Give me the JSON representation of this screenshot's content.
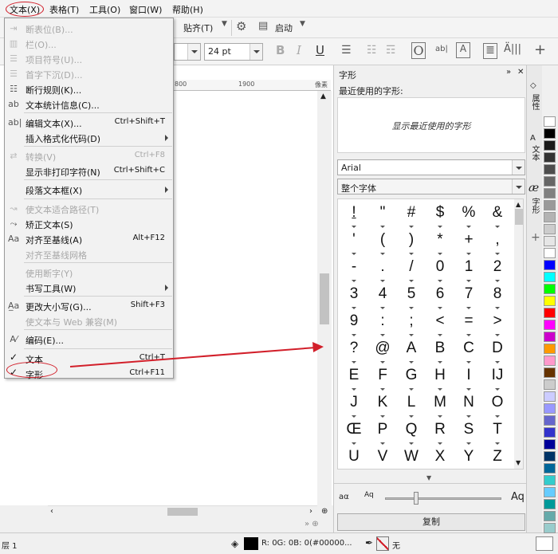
{
  "menubar": {
    "items": [
      "文本(X)",
      "表格(T)",
      "工具(O)",
      "窗口(W)",
      "帮助(H)"
    ]
  },
  "toolbar": {
    "snap_label": "贴齐(T)",
    "launch_label": "启动",
    "font_size": "24 pt"
  },
  "ruler": {
    "mark1": "800",
    "mark2": "1900",
    "unit": "像素"
  },
  "text_menu": {
    "items": [
      {
        "label": "断表位(B)...",
        "shortcut": "",
        "disabled": true,
        "submenu": false
      },
      {
        "label": "栏(O)...",
        "shortcut": "",
        "disabled": true,
        "submenu": false
      },
      {
        "label": "项目符号(U)...",
        "shortcut": "",
        "disabled": true,
        "submenu": false
      },
      {
        "label": "首字下沉(D)...",
        "shortcut": "",
        "disabled": true,
        "submenu": false
      },
      {
        "label": "断行规则(K)...",
        "shortcut": "",
        "disabled": false,
        "submenu": false
      },
      {
        "label": "文本统计信息(C)...",
        "shortcut": "",
        "disabled": false,
        "submenu": false
      },
      {
        "label": "编辑文本(X)...",
        "shortcut": "Ctrl+Shift+T",
        "disabled": false,
        "submenu": false
      },
      {
        "label": "插入格式化代码(D)",
        "shortcut": "",
        "disabled": false,
        "submenu": true
      },
      {
        "label": "转换(V)",
        "shortcut": "Ctrl+F8",
        "disabled": true,
        "submenu": false
      },
      {
        "label": "显示非打印字符(N)",
        "shortcut": "Ctrl+Shift+C",
        "disabled": false,
        "submenu": false
      },
      {
        "label": "段落文本框(X)",
        "shortcut": "",
        "disabled": false,
        "submenu": true
      },
      {
        "label": "使文本适合路径(T)",
        "shortcut": "",
        "disabled": true,
        "submenu": false
      },
      {
        "label": "矫正文本(S)",
        "shortcut": "",
        "disabled": false,
        "submenu": false
      },
      {
        "label": "对齐至基线(A)",
        "shortcut": "Alt+F12",
        "disabled": false,
        "submenu": false
      },
      {
        "label": "对齐至基线网格",
        "shortcut": "",
        "disabled": true,
        "submenu": false
      },
      {
        "label": "使用断字(Y)",
        "shortcut": "",
        "disabled": true,
        "submenu": false
      },
      {
        "label": "书写工具(W)",
        "shortcut": "",
        "disabled": false,
        "submenu": true
      },
      {
        "label": "更改大小写(G)...",
        "shortcut": "Shift+F3",
        "disabled": false,
        "submenu": false
      },
      {
        "label": "使文本与 Web 兼容(M)",
        "shortcut": "",
        "disabled": true,
        "submenu": false
      },
      {
        "label": "编码(E)...",
        "shortcut": "",
        "disabled": false,
        "submenu": false
      },
      {
        "label": "文本",
        "shortcut": "Ctrl+T",
        "disabled": false,
        "submenu": false
      },
      {
        "label": "字形",
        "shortcut": "Ctrl+F11",
        "disabled": false,
        "submenu": false
      }
    ]
  },
  "glyphs_panel": {
    "title": "字形",
    "recent_label": "最近使用的字形:",
    "recent_placeholder": "显示最近使用的字形",
    "font": "Arial",
    "subset": "整个字体",
    "glyphs": [
      "!",
      "\"",
      "#",
      "$",
      "%",
      "&",
      "'",
      "(",
      ")",
      "*",
      "+",
      ",",
      "-",
      ".",
      "/",
      "0",
      "1",
      "2",
      "3",
      "4",
      "5",
      "6",
      "7",
      "8",
      "9",
      ":",
      ";",
      "<",
      "=",
      ">",
      "?",
      "@",
      "A",
      "B",
      "C",
      "D",
      "E",
      "F",
      "G",
      "H",
      "I",
      "IJ",
      "J",
      "K",
      "L",
      "M",
      "N",
      "O",
      "Œ",
      "P",
      "Q",
      "R",
      "S",
      "T",
      "U",
      "V",
      "W",
      "X",
      "Y",
      "Z"
    ],
    "copy_button": "复制"
  },
  "side_tabs": [
    "属性",
    "文本",
    "字形"
  ],
  "status": {
    "left": "层 1",
    "color": "R: 0G: 0B: 0(#00000...",
    "none": "无"
  },
  "palette": [
    "#ffffff",
    "#000000",
    "#1a1a1a",
    "#333333",
    "#4d4d4d",
    "#666666",
    "#808080",
    "#999999",
    "#b3b3b3",
    "#cccccc",
    "#e6e6e6",
    "#ffffff",
    "#0000ff",
    "#00ffff",
    "#00ff00",
    "#ffff00",
    "#ff0000",
    "#ff00ff",
    "#cc00cc",
    "#ff9900",
    "#ff99cc",
    "#663300",
    "#cccccc",
    "#ccccff",
    "#9999ff",
    "#6666cc",
    "#3333cc",
    "#000099",
    "#003366",
    "#006699",
    "#33cccc",
    "#66ccff",
    "#009999",
    "#66aaaa",
    "#99cccc"
  ]
}
